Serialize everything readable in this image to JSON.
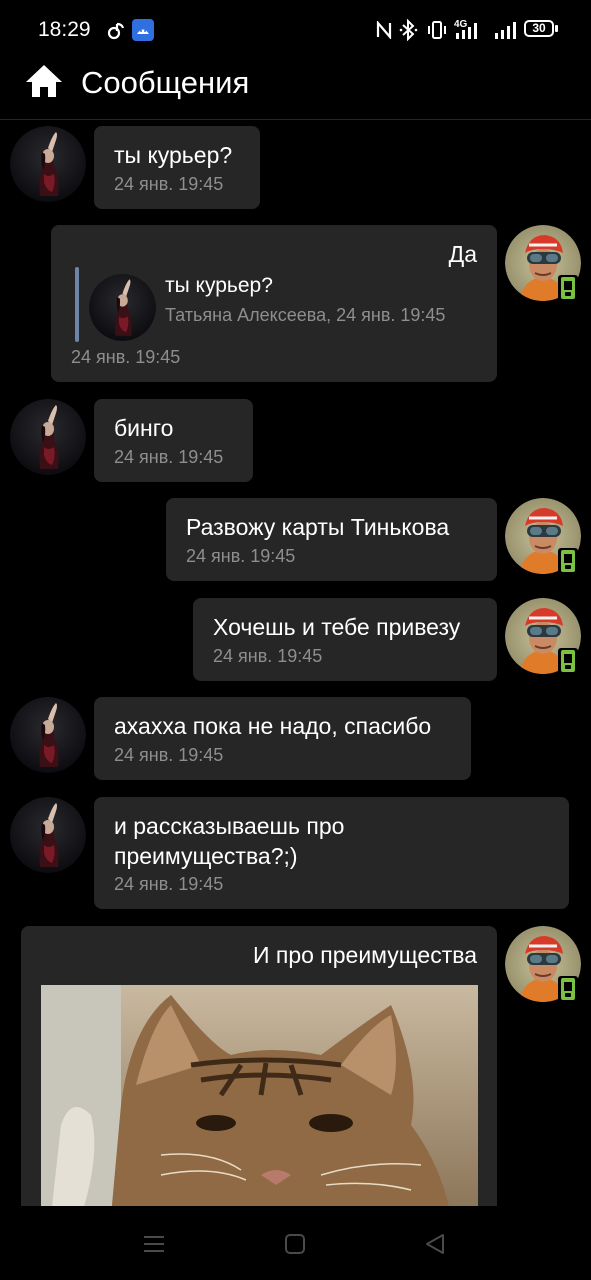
{
  "status_bar": {
    "time": "18:29",
    "battery": "30",
    "network": "4G"
  },
  "header": {
    "title": "Сообщения",
    "home_icon": "home-icon"
  },
  "messages": [
    {
      "side": "incoming",
      "text": "ты курьер?",
      "time": "24 янв. 19:45"
    },
    {
      "side": "outgoing",
      "text": "Да",
      "time": "24 янв. 19:45",
      "reply": {
        "text": "ты курьер?",
        "author_time": "Татьяна Алексеева, 24 янв. 19:45"
      }
    },
    {
      "side": "incoming",
      "text": "бинго",
      "time": "24 янв. 19:45"
    },
    {
      "side": "outgoing",
      "text": "Развожу карты Тинькова",
      "time": "24 янв. 19:45"
    },
    {
      "side": "outgoing",
      "text": "Хочешь и тебе привезу",
      "time": "24 янв. 19:45"
    },
    {
      "side": "incoming",
      "text": "ахахха пока не надо, спасибо",
      "time": "24 янв. 19:45"
    },
    {
      "side": "incoming",
      "text_lines": [
        "и рассказываешь про",
        "преимущества?;)"
      ],
      "time": "24 янв. 19:45"
    },
    {
      "side": "outgoing",
      "text": "И про преимущества",
      "attachment": "cat-photo"
    }
  ],
  "nav_bar": {
    "items": [
      "menu-icon",
      "home-square-icon",
      "back-triangle-icon"
    ]
  },
  "colors": {
    "background": "#000000",
    "bubble": "#262626",
    "timestamp": "#8e8e8e",
    "reply_bar": "#6e85a8",
    "mobile_badge": "#7cc242"
  }
}
